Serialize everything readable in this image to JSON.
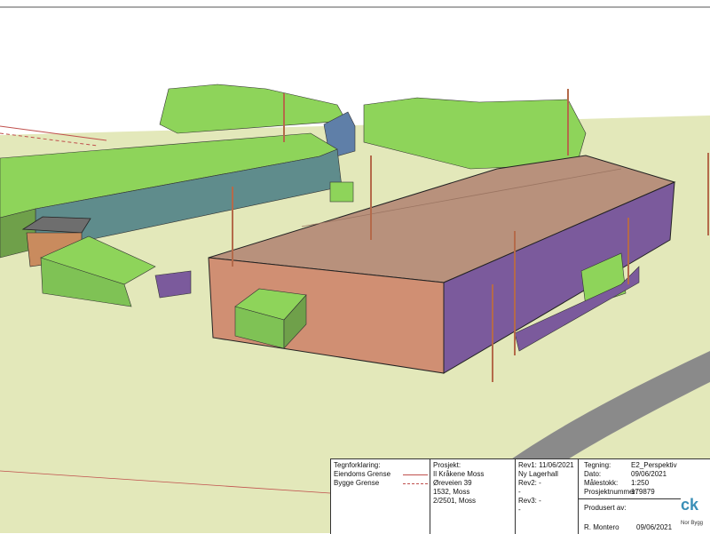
{
  "title_block": {
    "legend": {
      "heading": "Tegnforklaring:",
      "property_boundary": "Eiendoms Grense",
      "building_boundary": "Bygge Grense"
    },
    "project": {
      "heading": "Prosjekt:",
      "line1": "Il Kråkene Moss",
      "line2": "Øreveien 39",
      "line3": "1532, Moss",
      "line4": "2/2501, Moss"
    },
    "revisions": {
      "rev1_label": "Rev1:",
      "rev1_date": "11/06/2021",
      "rev1_desc": "Ny Lagerhall",
      "rev2_label": "Rev2:",
      "rev2_value": "-",
      "rev2_extra": "-",
      "rev3_label": "Rev3:",
      "rev3_value": "-",
      "rev3_extra": "-"
    },
    "drawing": {
      "drawing_label": "Tegning:",
      "drawing_value": "E2_Perspektiv",
      "date_label": "Dato:",
      "date_value": "09/06/2021",
      "scale_label": "Målestokk:",
      "scale_value": "1:250",
      "project_number_label": "Prosjektnummer:",
      "project_number_value": "179879",
      "produced_by_label": "Produsert av:",
      "produced_by_name": "R. Montero",
      "produced_by_date": "09/06/2021"
    },
    "logo": {
      "mark": "ck",
      "sub": "Nor Bygg"
    }
  },
  "colors": {
    "ground": "#e3e8ba",
    "green_roof": "#8ed45a",
    "green_wall": "#6fa04a",
    "hall_roof": "#b8917c",
    "hall_front": "#d08f73",
    "hall_side": "#7b5a9c",
    "road": "#8a8a8a",
    "pole": "#b46a4a",
    "boundary": "#c0504d"
  }
}
